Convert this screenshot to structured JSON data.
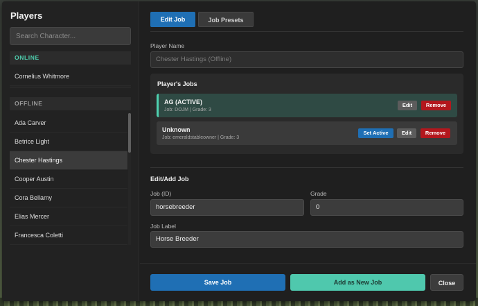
{
  "sidebar": {
    "title": "Players",
    "search_placeholder": "Search Character...",
    "online_header": "ONLINE",
    "online_players": [
      "Cornelius Whitmore"
    ],
    "offline_header": "OFFLINE",
    "offline_players": [
      "Ada Carver",
      "Betrice Light",
      "Chester Hastings",
      "Cooper Austin",
      "Cora Bellamy",
      "Elias Mercer",
      "Francesca Coletti"
    ],
    "selected_player": "Chester Hastings"
  },
  "tabs": {
    "edit_job": "Edit Job",
    "job_presets": "Job Presets"
  },
  "player_name": {
    "label": "Player Name",
    "value": "Chester Hastings (Offline)"
  },
  "players_jobs": {
    "title": "Player's Jobs",
    "jobs": [
      {
        "name": "AG (ACTIVE)",
        "meta": "Job: DOJM | Grade: 3",
        "edit_label": "Edit",
        "remove_label": "Remove"
      },
      {
        "name": "Unknown",
        "meta": "Job: emeraldstableowner | Grade: 3",
        "set_active_label": "Set Active",
        "edit_label": "Edit",
        "remove_label": "Remove"
      }
    ]
  },
  "edit_add": {
    "title": "Edit/Add Job",
    "job_id_label": "Job (ID)",
    "job_id_value": "horsebreeder",
    "grade_label": "Grade",
    "grade_value": "0",
    "job_label_label": "Job Label",
    "job_label_value": "Horse Breeder"
  },
  "footer": {
    "save": "Save Job",
    "add_new": "Add as New Job",
    "close": "Close"
  },
  "colors": {
    "accent_blue": "#1f6fb4",
    "accent_teal": "#4fc8ad",
    "danger_red": "#b3171d",
    "panel_bg": "#1f1f1f"
  }
}
